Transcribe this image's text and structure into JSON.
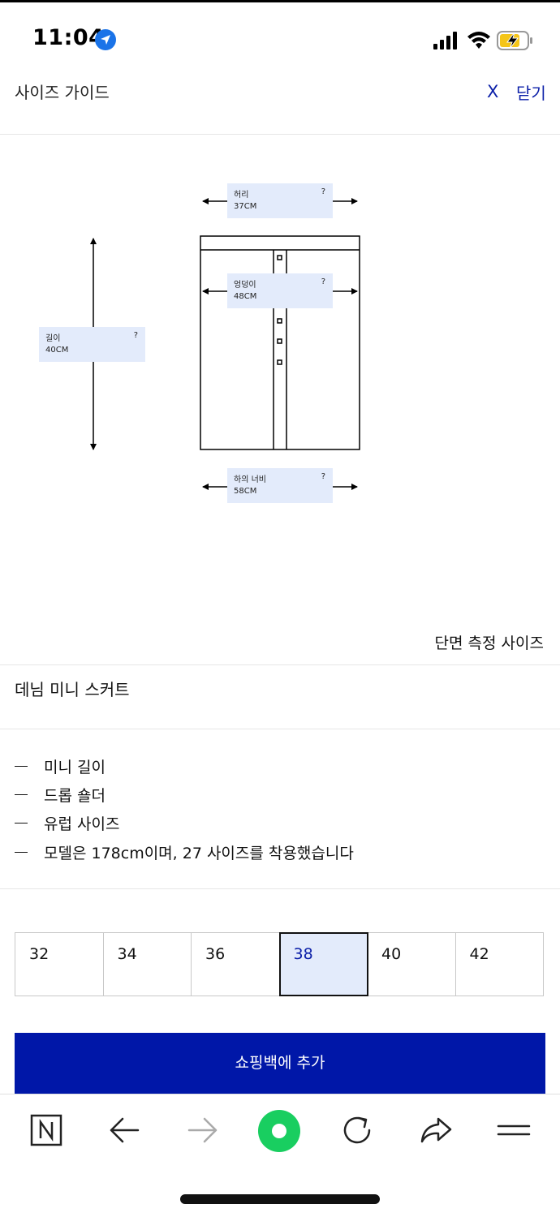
{
  "status_bar": {
    "time": "11:04",
    "icons": [
      "location-arrow-icon",
      "cellular-signal-icon",
      "wifi-icon",
      "battery-charging-icon"
    ],
    "accent_color": "#1a73e8",
    "battery_color": "#f5c518"
  },
  "header": {
    "title": "사이즈 가이드",
    "close_x": "X",
    "close_label": "닫기"
  },
  "diagram": {
    "measurements": [
      {
        "name": "허리",
        "value": "37CM",
        "help": "?"
      },
      {
        "name": "엉덩이",
        "value": "48CM",
        "help": "?"
      },
      {
        "name": "길이",
        "value": "40CM",
        "help": "?"
      },
      {
        "name": "하의 너비",
        "value": "58CM",
        "help": "?"
      }
    ],
    "note": "단면 측정 사이즈",
    "highlight_color": "#e3ebfb"
  },
  "product": {
    "name": "데님 미니 스커트",
    "features": [
      "미니 길이",
      "드롭 숄더",
      "유럽 사이즈",
      "모델은 178cm이며, 27 사이즈를 착용했습니다"
    ]
  },
  "sizes": {
    "options": [
      "32",
      "34",
      "36",
      "38",
      "40",
      "42"
    ],
    "selected": "38"
  },
  "add_button": {
    "label": "쇼핑백에 추가",
    "color": "#0017a8"
  },
  "browser_nav": {
    "icons": [
      "naver-n-icon",
      "back-arrow-icon",
      "forward-arrow-icon",
      "green-dot-icon",
      "reload-icon",
      "share-icon",
      "menu-icon"
    ],
    "green_color": "#19ce60"
  }
}
